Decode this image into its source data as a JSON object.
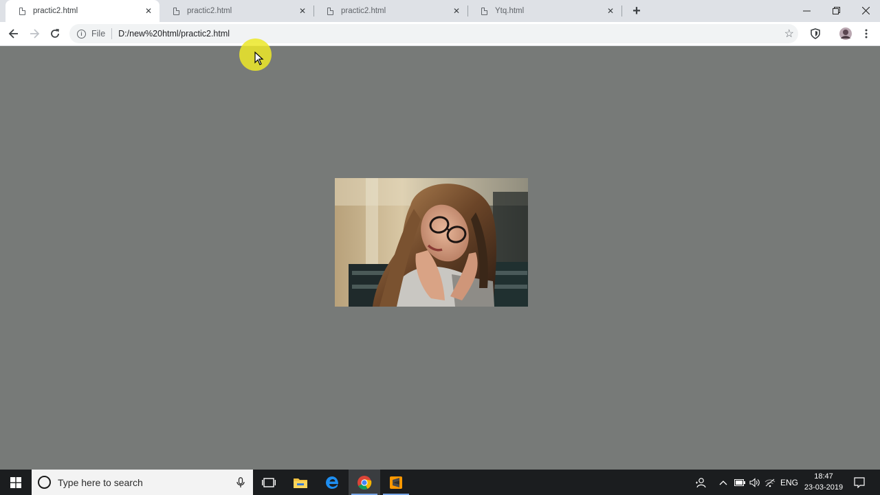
{
  "browser": {
    "tabs": [
      {
        "title": "practic2.html",
        "active": true
      },
      {
        "title": "practic2.html",
        "active": false
      },
      {
        "title": "practic2.html",
        "active": false
      },
      {
        "title": "Ytq.html",
        "active": false
      }
    ],
    "new_tab_icon": "plus-icon",
    "window_controls": [
      "minimize-icon",
      "restore-icon",
      "close-icon"
    ]
  },
  "toolbar": {
    "url_scheme_label": "File",
    "url": "D:/new%20html/practic2.html"
  },
  "page": {
    "background": "#777a78",
    "image_icon": "photo-of-woman-with-glasses"
  },
  "taskbar": {
    "search_placeholder": "Type here to search",
    "apps": [
      "task-view-icon",
      "file-explorer-icon",
      "edge-icon",
      "chrome-icon",
      "sublime-text-icon"
    ],
    "language": "ENG",
    "time": "18:47",
    "date": "23-03-2019"
  }
}
